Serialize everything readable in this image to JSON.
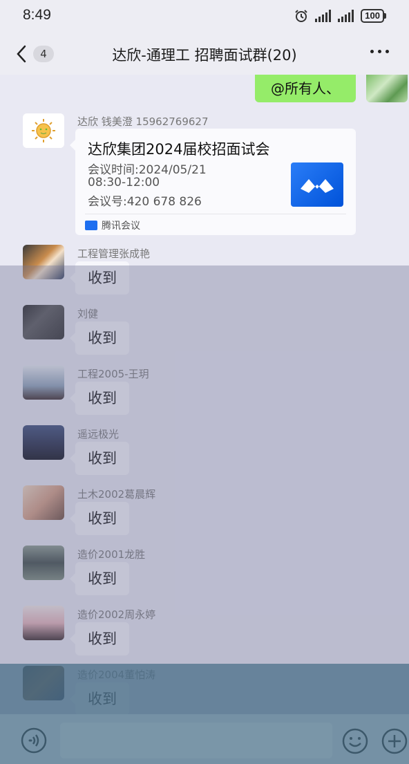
{
  "status_bar": {
    "time": "8:49",
    "battery": "100"
  },
  "nav": {
    "unread_count": "4",
    "title": "达欣-通理工 招聘面试群(20)"
  },
  "top_bubble": {
    "text": "@所有人、"
  },
  "meeting_message": {
    "sender": "达欣 钱美澄 15962769627",
    "card": {
      "title": "达欣集团2024届校招面试会",
      "time_label": "会议时间:2024/05/21",
      "time_range": "08:30-12:00",
      "meeting_id": "会议号:420 678 826",
      "source": "腾讯会议"
    }
  },
  "replies": [
    {
      "sender": "工程管理张成艳",
      "text": "收到"
    },
    {
      "sender": "刘健",
      "text": "收到"
    },
    {
      "sender": "工程2005-王玥",
      "text": "收到"
    },
    {
      "sender": "遥远极光",
      "text": "收到"
    },
    {
      "sender": "土木2002葛晨辉",
      "text": "收到"
    },
    {
      "sender": "造价2001龙胜",
      "text": "收到"
    },
    {
      "sender": "造价2002周永婷",
      "text": "收到"
    },
    {
      "sender": "造价2004董怕涛",
      "text": "收到"
    }
  ],
  "input": {
    "placeholder": ""
  },
  "colors": {
    "self_bubble": "#95ec69",
    "other_bubble": "#f6f6fb",
    "meeting_brand": "#0052d9"
  }
}
